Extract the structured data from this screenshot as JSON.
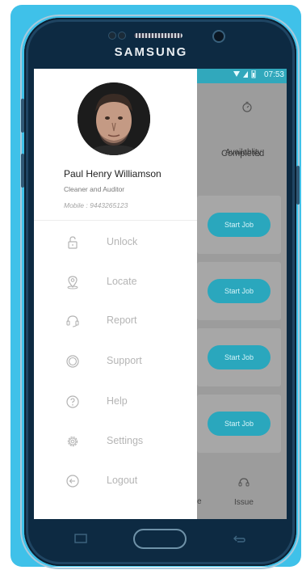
{
  "device": {
    "brand": "SAMSUNG"
  },
  "status_bar": {
    "time": "07:53"
  },
  "drawer": {
    "profile": {
      "name": "Paul Henry Williamson",
      "role": "Cleaner and Auditor",
      "mobile": "Mobile : 9443265123"
    },
    "menu": [
      {
        "label": "Unlock",
        "icon": "lock-icon"
      },
      {
        "label": "Locate",
        "icon": "location-pin-icon"
      },
      {
        "label": "Report",
        "icon": "report-icon"
      },
      {
        "label": "Support",
        "icon": "support-icon"
      },
      {
        "label": "Help",
        "icon": "help-icon"
      },
      {
        "label": "Settings",
        "icon": "gear-icon"
      },
      {
        "label": "Logout",
        "icon": "logout-icon"
      }
    ]
  },
  "background_app": {
    "availability_label": "Availablity",
    "completed_tab": "Completed",
    "start_job_buttons": [
      "Start Job",
      "Start Job",
      "Start Job",
      "Start Job"
    ],
    "bottom_fragment": "e",
    "issue_label": "Issue"
  },
  "colors": {
    "accent": "#31a8bc",
    "frame": "#0d2a42",
    "background": "#3fc1e9"
  }
}
